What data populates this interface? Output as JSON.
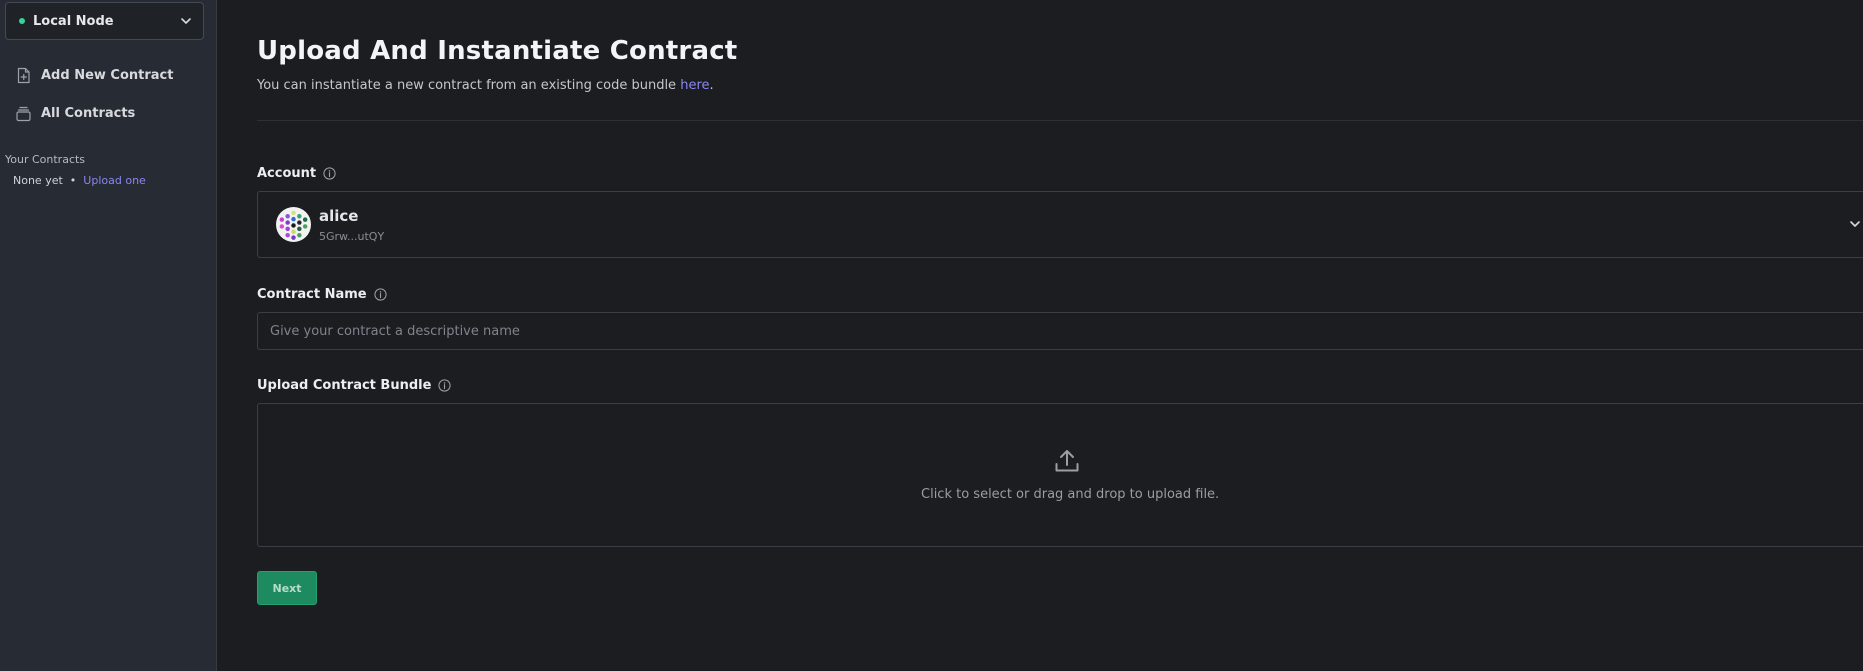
{
  "sidebar": {
    "node_selector": {
      "label": "Local Node",
      "status_color": "#34d399"
    },
    "nav": [
      {
        "label": "Add New Contract",
        "icon": "file-plus-icon"
      },
      {
        "label": "All Contracts",
        "icon": "collection-icon"
      }
    ],
    "your_contracts": {
      "heading": "Your Contracts",
      "empty_text": "None yet",
      "separator": "•",
      "upload_link": "Upload one"
    }
  },
  "main": {
    "title": "Upload And Instantiate Contract",
    "subtitle_prefix": "You can instantiate a new contract from an existing code bundle ",
    "subtitle_link": "here",
    "subtitle_suffix": ".",
    "account": {
      "label": "Account",
      "name": "alice",
      "address": "5Grw...utQY"
    },
    "contract_name": {
      "label": "Contract Name",
      "placeholder": "Give your contract a descriptive name",
      "value": ""
    },
    "upload": {
      "label": "Upload Contract Bundle",
      "hint": "Click to select or drag and drop to upload file."
    },
    "next_button": "Next"
  },
  "colors": {
    "background": "#1b1d20",
    "sidebar": "#272b33",
    "accent_link": "#8b86f1",
    "primary_button": "#1d8a60"
  }
}
